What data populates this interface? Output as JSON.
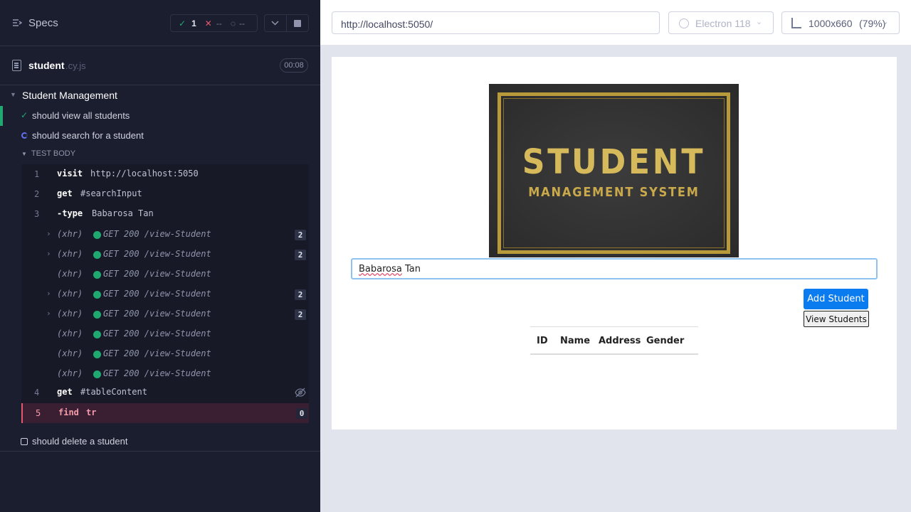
{
  "reporter": {
    "header": {
      "title": "Specs",
      "passed": "1",
      "failed": "--",
      "pending": "--"
    },
    "spec": {
      "name": "student",
      "ext": ".cy.js",
      "time": "00:08"
    },
    "suite": {
      "title": "Student Management"
    },
    "tests": [
      {
        "title": "should view all students",
        "state": "passed"
      },
      {
        "title": "should search for a student",
        "state": "running"
      },
      {
        "title": "should delete a student",
        "state": "pending"
      }
    ],
    "test_body_label": "TEST BODY",
    "commands": {
      "c1": {
        "num": "1",
        "name": "visit",
        "msg": "http://localhost:5050"
      },
      "c2": {
        "num": "2",
        "name": "get",
        "msg": "#searchInput"
      },
      "c3": {
        "num": "3",
        "name": "-type",
        "msg": "Babarosa Tan"
      },
      "xhr": [
        {
          "kind": "(xhr)",
          "route": "GET 200 /view-Student",
          "count": "2"
        },
        {
          "kind": "(xhr)",
          "route": "GET 200 /view-Student",
          "count": "2"
        },
        {
          "kind": "(xhr)",
          "route": "GET 200 /view-Student",
          "count": ""
        },
        {
          "kind": "(xhr)",
          "route": "GET 200 /view-Student",
          "count": "2"
        },
        {
          "kind": "(xhr)",
          "route": "GET 200 /view-Student",
          "count": "2"
        },
        {
          "kind": "(xhr)",
          "route": "GET 200 /view-Student",
          "count": ""
        },
        {
          "kind": "(xhr)",
          "route": "GET 200 /view-Student",
          "count": ""
        },
        {
          "kind": "(xhr)",
          "route": "GET 200 /view-Student",
          "count": ""
        }
      ],
      "c4": {
        "num": "4",
        "name": "get",
        "msg": "#tableContent"
      },
      "c5": {
        "num": "5",
        "name": "find",
        "msg": "tr",
        "count": "0"
      }
    }
  },
  "toolbar": {
    "url": "http://localhost:5050/",
    "browser": "Electron 118",
    "viewport": "1000x660",
    "scale": "(79%)"
  },
  "app": {
    "logo_line1": "STUDENT",
    "logo_line2": "MANAGEMENT SYSTEM",
    "search_value_word1": "Babarosa",
    "search_value_word2": " Tan",
    "add_button": "Add Student",
    "view_button": "View Students",
    "table_headers": [
      "ID",
      "Name",
      "Address",
      "Gender"
    ]
  },
  "colors": {
    "reporter_bg": "#1b1e2e",
    "pass": "#1fa971",
    "fail": "#e45770",
    "running": "#6470f3",
    "primary_button": "#0b7bf0"
  }
}
